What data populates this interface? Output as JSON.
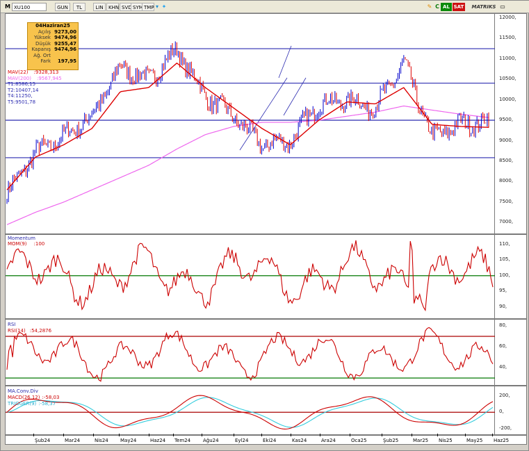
{
  "toolbar": {
    "symbol_label": "M",
    "symbol": "XU100",
    "period_buttons": [
      "GUN",
      "TL",
      "LIN",
      "KHN",
      "SVD",
      "SYM",
      "TMP"
    ],
    "buy_label": "AL",
    "sell_label": "SAT",
    "brand": "MATRIKS",
    "icons": [
      "pencil-icon",
      "c-icon",
      "twitter-icon"
    ]
  },
  "colors": {
    "price_up": "#0000cc",
    "price_down": "#dd0000",
    "mav22": "#dd0000",
    "mav200": "#ee66ee",
    "hline": "#2b2bb0",
    "momentum": "#cc0000",
    "rsi": "#cc0000",
    "macd": "#cc0000",
    "trigger": "#33ccdd",
    "ref_green": "#007700",
    "ref_darkred": "#aa0000",
    "buy_bg": "#0a8a0a",
    "sell_bg": "#cc1111"
  },
  "infobox": {
    "date": "04Haziran25",
    "rows": [
      {
        "k": "Açılış",
        "v": "9273,00"
      },
      {
        "k": "Yüksek",
        "v": "9474,96"
      },
      {
        "k": "Düşük",
        "v": "9255,47"
      },
      {
        "k": "Kapanış",
        "v": "9474,96"
      },
      {
        "k": "Ağ. Ort",
        "v": ""
      },
      {
        "k": "Fark",
        "v": "197,95"
      }
    ]
  },
  "price_legend": [
    {
      "label": "MAV(22)",
      "value": ":9328,313",
      "color": "#dd0000"
    },
    {
      "label": "MAV(200)",
      "value": ":9567,945",
      "color": "#ee66ee"
    },
    {
      "label": "T1:8586,15",
      "value": "",
      "color": "#2b2bb0"
    },
    {
      "label": "T2:10407,14",
      "value": "",
      "color": "#2b2bb0"
    },
    {
      "label": "T4:11250,",
      "value": "",
      "color": "#2b2bb0"
    },
    {
      "label": "T5:9501,78",
      "value": "",
      "color": "#2b2bb0"
    }
  ],
  "price_axis": [
    "12000,",
    "11500,",
    "11000,",
    "10500,",
    "10000,",
    "9500,",
    "9000,",
    "8500,",
    "8000,",
    "7500,",
    "7000,"
  ],
  "momentum": {
    "title": "Momentum",
    "legend": "MOM(9)",
    "value": ":100",
    "axis": [
      "110,",
      "105,",
      "100,",
      "95,",
      "90,"
    ]
  },
  "rsi": {
    "title": "RSI",
    "legend": "RSI(14)",
    "value": ":54,2876",
    "axis": [
      "80,",
      "60,",
      "40,"
    ]
  },
  "macd": {
    "title": "MA.Conv.Div",
    "legend1": "MACD(26,12)",
    "value1": ":-58,03",
    "legend2": "TRIGGER(9)",
    "value2": ":-58,37",
    "axis": [
      "200,",
      "0,",
      "-200,"
    ]
  },
  "xaxis": [
    "Şub24",
    "Mar24",
    "Nis24",
    "May24",
    "Haz24",
    "Tem24",
    "Ağu24",
    "Eyl24",
    "Eki24",
    "Kas24",
    "Ara24",
    "Oca25",
    "Şub25",
    "Mar25",
    "Nis25",
    "May25",
    "Haz25"
  ],
  "chart_data": {
    "type": "line",
    "title": "",
    "xlabel": "",
    "ylabel": "",
    "x": [
      "Şub24",
      "Mar24",
      "Nis24",
      "May24",
      "Haz24",
      "Tem24",
      "Ağu24",
      "Eyl24",
      "Eki24",
      "Kas24",
      "Ara24",
      "Oca25",
      "Şub25",
      "Mar25",
      "Nis25",
      "May25",
      "Haz25"
    ],
    "ylim": [
      6700,
      12100
    ],
    "hlines": [
      8586.15,
      10407.14,
      11250,
      9501.78
    ],
    "series": [
      {
        "name": "XU100",
        "values": [
          7700,
          8700,
          9100,
          9600,
          10800,
          10500,
          11200,
          10100,
          9600,
          8900,
          9000,
          9900,
          10000,
          9800,
          10900,
          9100,
          9400,
          9470
        ]
      },
      {
        "name": "MAV(22)",
        "values": [
          7800,
          8600,
          8900,
          9300,
          10200,
          10300,
          10900,
          10300,
          9800,
          9300,
          8900,
          9500,
          9950,
          9900,
          10300,
          9400,
          9350,
          9328
        ]
      },
      {
        "name": "MAV(200)",
        "values": [
          6950,
          7250,
          7500,
          7800,
          8100,
          8400,
          8800,
          9150,
          9350,
          9450,
          9450,
          9500,
          9600,
          9700,
          9850,
          9750,
          9650,
          9568
        ]
      }
    ]
  }
}
